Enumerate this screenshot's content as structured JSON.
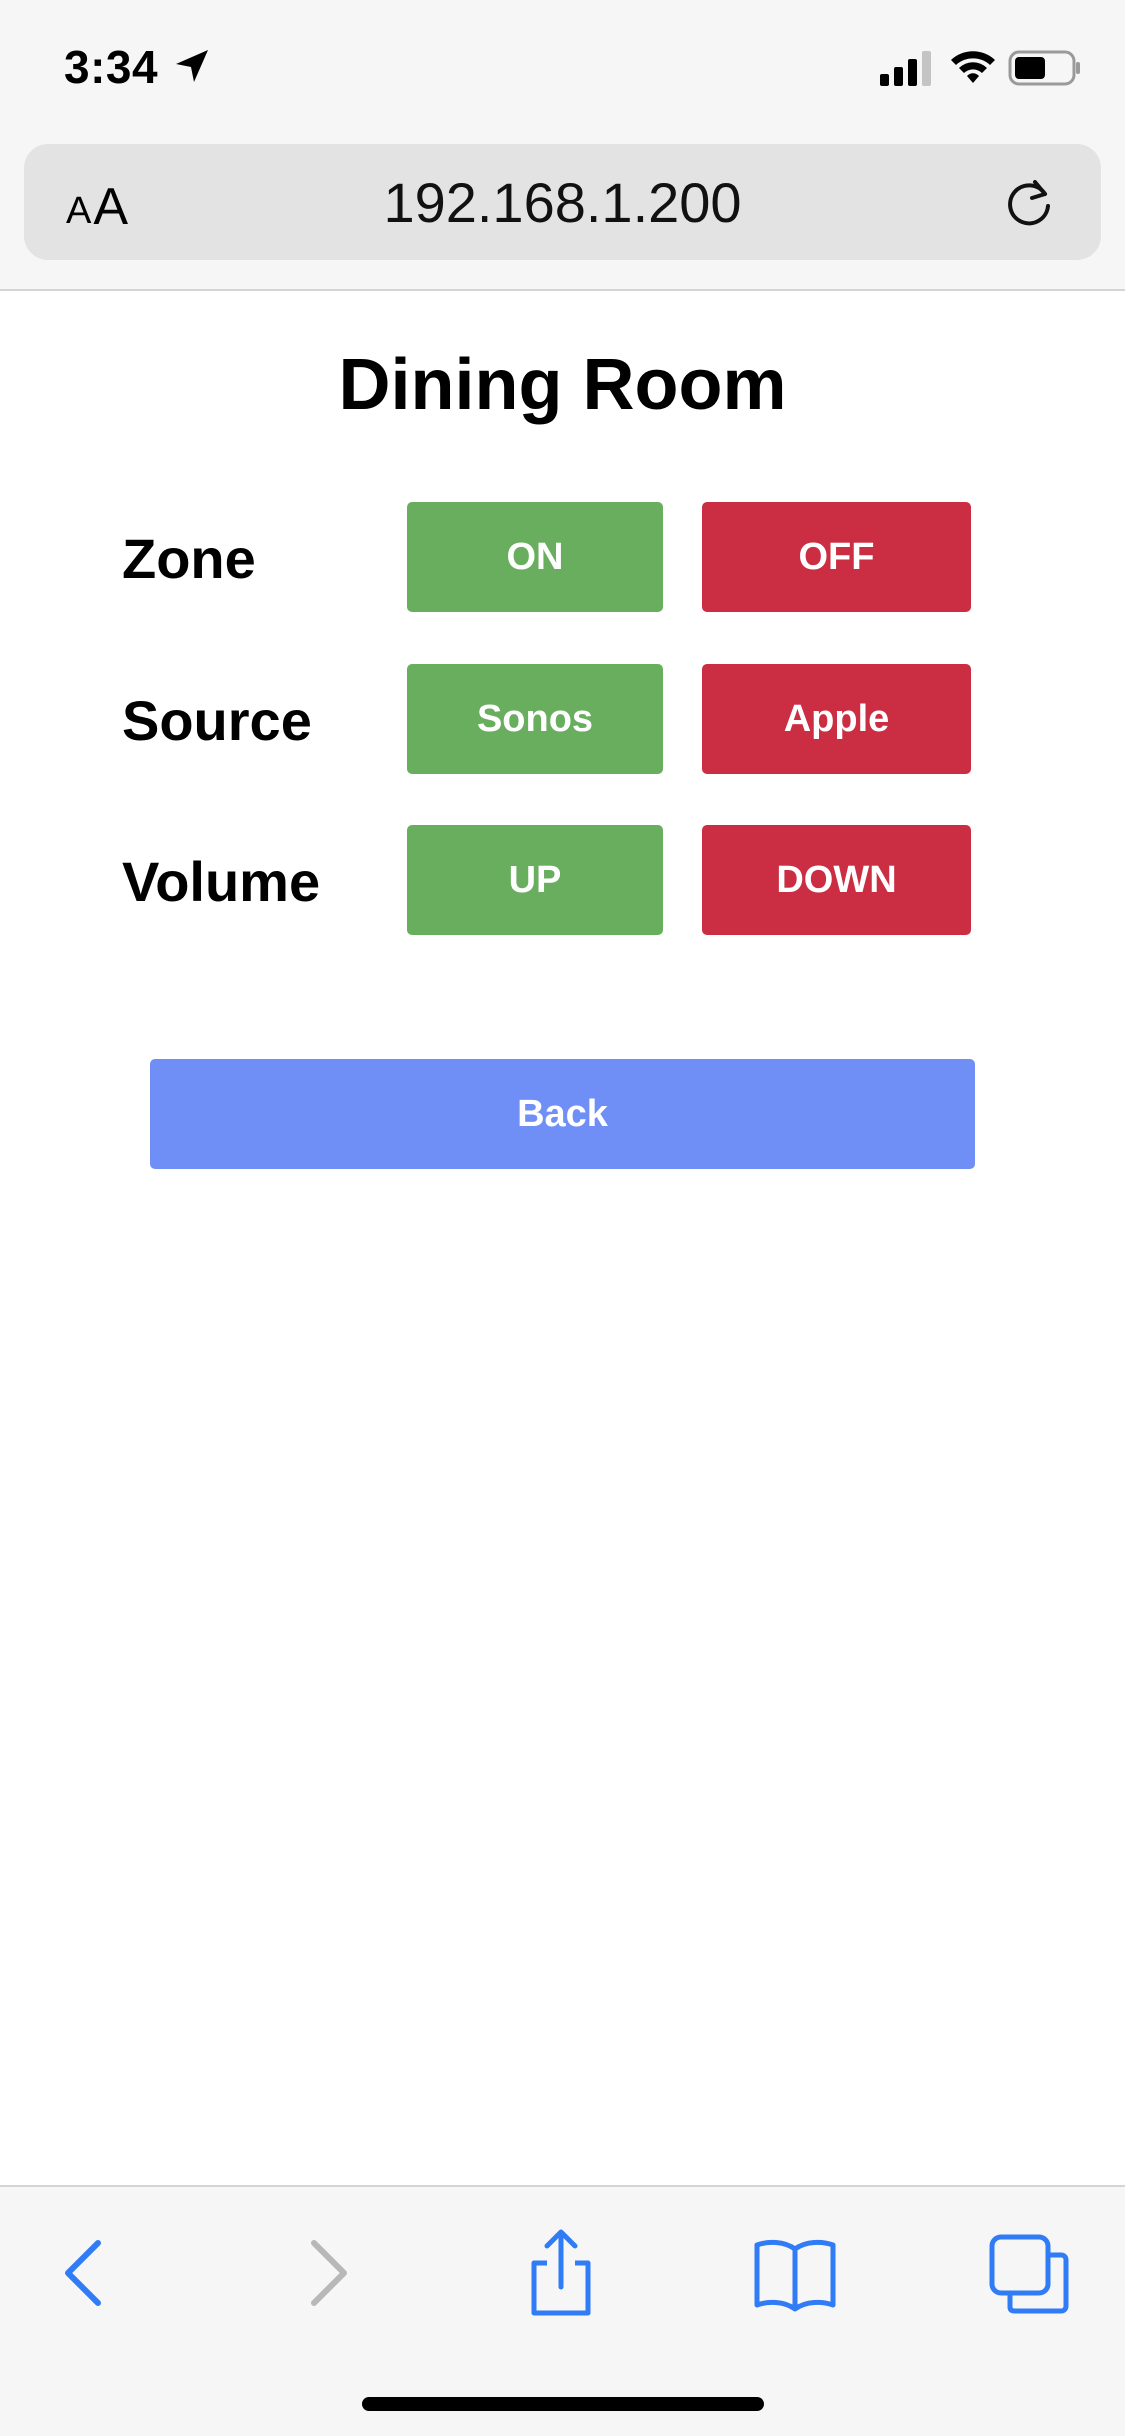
{
  "status_bar": {
    "time": "3:34",
    "icons": [
      "location-arrow-icon",
      "cellular-signal-icon",
      "wifi-icon",
      "battery-icon"
    ]
  },
  "browser": {
    "text_size_small": "A",
    "text_size_large": "A",
    "url": "192.168.1.200",
    "toolbar_icons": [
      "back-chevron-icon",
      "forward-chevron-icon",
      "share-icon",
      "bookmarks-icon",
      "tabs-icon"
    ]
  },
  "page": {
    "title": "Dining Room",
    "rows": [
      {
        "label": "Zone",
        "green_label": "ON",
        "red_label": "OFF"
      },
      {
        "label": "Source",
        "green_label": "Sonos",
        "red_label": "Apple"
      },
      {
        "label": "Volume",
        "green_label": "UP",
        "red_label": "DOWN"
      }
    ],
    "back_label": "Back"
  },
  "colors": {
    "green_button": "#69ae5f",
    "red_button": "#cb2e43",
    "back_button": "#6f8ff7",
    "ios_blue": "#2f7cf6"
  }
}
